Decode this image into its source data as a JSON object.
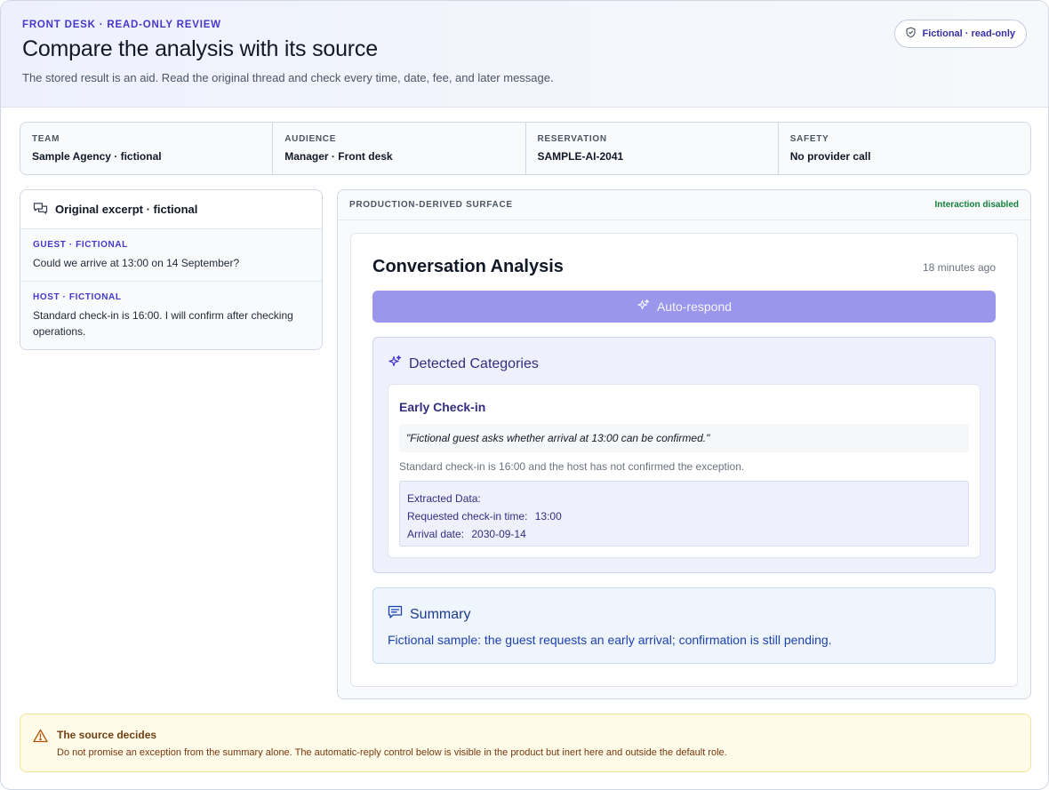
{
  "header": {
    "eyebrow": "FRONT DESK · READ-ONLY REVIEW",
    "title": "Compare the analysis with its source",
    "subtitle": "The stored result is an aid. Read the original thread and check every time, date, fee, and later message.",
    "badge": "Fictional · read-only"
  },
  "meta": [
    {
      "label": "TEAM",
      "value": "Sample Agency · fictional"
    },
    {
      "label": "AUDIENCE",
      "value": "Manager · Front desk"
    },
    {
      "label": "RESERVATION",
      "value": "SAMPLE-AI-2041"
    },
    {
      "label": "SAFETY",
      "value": "No provider call"
    }
  ],
  "excerpt": {
    "title": "Original excerpt · fictional",
    "messages": [
      {
        "role": "GUEST · FICTIONAL",
        "text": "Could we arrive at 13:00 on 14 September?"
      },
      {
        "role": "HOST · FICTIONAL",
        "text": "Standard check-in is 16:00. I will confirm after checking operations."
      }
    ]
  },
  "surface": {
    "label": "PRODUCTION-DERIVED SURFACE",
    "status": "Interaction disabled",
    "analysis": {
      "title": "Conversation Analysis",
      "time": "18 minutes ago",
      "auto_respond": "Auto-respond",
      "categories_title": "Detected Categories",
      "category": {
        "name": "Early Check-in",
        "quote": "\"Fictional guest asks whether arrival at 13:00 can be confirmed.\"",
        "explanation": "Standard check-in is 16:00 and the host has not confirmed the exception.",
        "extracted_title": "Extracted Data:",
        "fields": [
          {
            "key": "Requested check-in time:",
            "value": "13:00"
          },
          {
            "key": "Arrival date:",
            "value": "2030-09-14"
          }
        ]
      },
      "summary_title": "Summary",
      "summary_text": "Fictional sample: the guest requests an early arrival; confirmation is still pending."
    }
  },
  "warning": {
    "title": "The source decides",
    "text": "Do not promise an exception from the summary alone. The automatic-reply control below is visible in the product but inert here and outside the default role."
  },
  "colors": {
    "accent": "#4338ca",
    "button": "#9a96ec",
    "success": "#15803d",
    "warning_bg": "#fefce8"
  }
}
